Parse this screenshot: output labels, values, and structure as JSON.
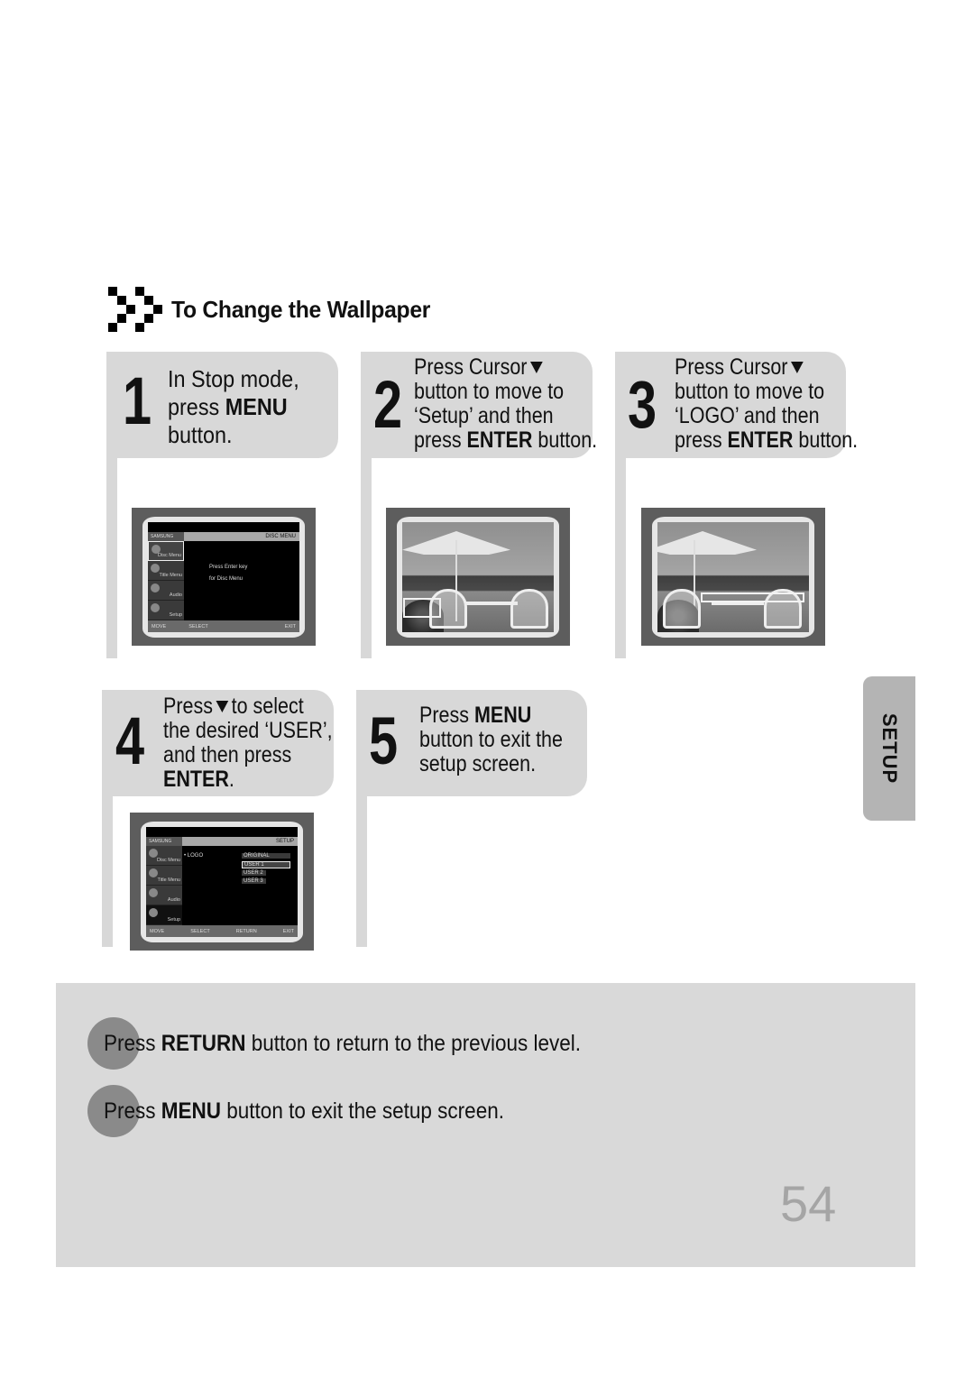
{
  "section": {
    "title": "To Change the Wallpaper",
    "icon": "checker-arrow-icon"
  },
  "steps": [
    {
      "number": "1",
      "lines": [
        {
          "parts": [
            {
              "t": "In Stop mode,",
              "b": false
            }
          ]
        },
        {
          "parts": [
            {
              "t": "press ",
              "b": false
            },
            {
              "t": "MENU",
              "b": true
            }
          ]
        },
        {
          "parts": [
            {
              "t": "button.",
              "b": false
            }
          ]
        }
      ],
      "screen": {
        "type": "osd",
        "brand": "SAMSUNG",
        "header": "DISC MENU",
        "side_items": [
          "Disc Menu",
          "Title Menu",
          "Audio",
          "Setup"
        ],
        "selected_side": 0,
        "main_lines": [
          "Press Enter key",
          "for Disc Menu"
        ],
        "footer": [
          "MOVE",
          "SELECT",
          "EXIT"
        ]
      }
    },
    {
      "number": "2",
      "lines": [
        {
          "parts": [
            {
              "t": "Press Cursor",
              "b": false
            }
          ],
          "arrow": true
        },
        {
          "parts": [
            {
              "t": "button to move to",
              "b": false
            }
          ]
        },
        {
          "parts": [
            {
              "t": "‘Setup’ and then",
              "b": false
            }
          ]
        },
        {
          "parts": [
            {
              "t": "press ",
              "b": false
            },
            {
              "t": "ENTER",
              "b": true
            },
            {
              "t": " button.",
              "b": false
            }
          ]
        }
      ],
      "screen": {
        "type": "photo",
        "highlight": "bottom-left"
      }
    },
    {
      "number": "3",
      "lines": [
        {
          "parts": [
            {
              "t": "Press Cursor",
              "b": false
            }
          ],
          "arrow": true
        },
        {
          "parts": [
            {
              "t": "button to move to",
              "b": false
            }
          ]
        },
        {
          "parts": [
            {
              "t": "‘LOGO’ and then",
              "b": false
            }
          ]
        },
        {
          "parts": [
            {
              "t": "press ",
              "b": false
            },
            {
              "t": "ENTER",
              "b": true
            },
            {
              "t": " button.",
              "b": false
            }
          ]
        }
      ],
      "screen": {
        "type": "photo",
        "highlight": "center-strip"
      }
    },
    {
      "number": "4",
      "lines": [
        {
          "parts": [
            {
              "t": "Press",
              "b": false
            }
          ],
          "arrow": true,
          "after": "to select"
        },
        {
          "parts": [
            {
              "t": "the desired ‘USER’,",
              "b": false
            }
          ]
        },
        {
          "parts": [
            {
              "t": "and then press",
              "b": false
            }
          ]
        },
        {
          "parts": [
            {
              "t": "ENTER",
              "b": true
            },
            {
              "t": ".",
              "b": false
            }
          ]
        }
      ],
      "screen": {
        "type": "osd",
        "brand": "SAMSUNG",
        "header": "SETUP",
        "side_items": [
          "Disc Menu",
          "Title Menu",
          "Audio",
          "Setup"
        ],
        "selected_side": -1,
        "logo_label": "• LOGO",
        "options": [
          "ORIGINAL",
          "USER 1",
          "USER 2",
          "USER 3"
        ],
        "selected_option": 1,
        "footer": [
          "MOVE",
          "SELECT",
          "RETURN",
          "EXIT"
        ]
      }
    },
    {
      "number": "5",
      "lines": [
        {
          "parts": [
            {
              "t": "Press ",
              "b": false
            },
            {
              "t": "MENU",
              "b": true
            }
          ]
        },
        {
          "parts": [
            {
              "t": "button to exit the",
              "b": false
            }
          ]
        },
        {
          "parts": [
            {
              "t": "setup screen.",
              "b": false
            }
          ]
        }
      ]
    }
  ],
  "side_tab": {
    "label": "SETUP"
  },
  "notes": [
    {
      "pre": "Press ",
      "bold": "RETURN",
      "post": " button to return to the previous level."
    },
    {
      "pre": "Press ",
      "bold": "MENU",
      "post": " button to exit the setup screen."
    }
  ],
  "page_number": "54",
  "colors": {
    "step_box": "#d8d8d8",
    "notes_bg": "#d9d9d9",
    "tab_bg": "#b4b4b4",
    "note_dot": "#8a8a8a",
    "page_number": "#a5a5a5"
  }
}
